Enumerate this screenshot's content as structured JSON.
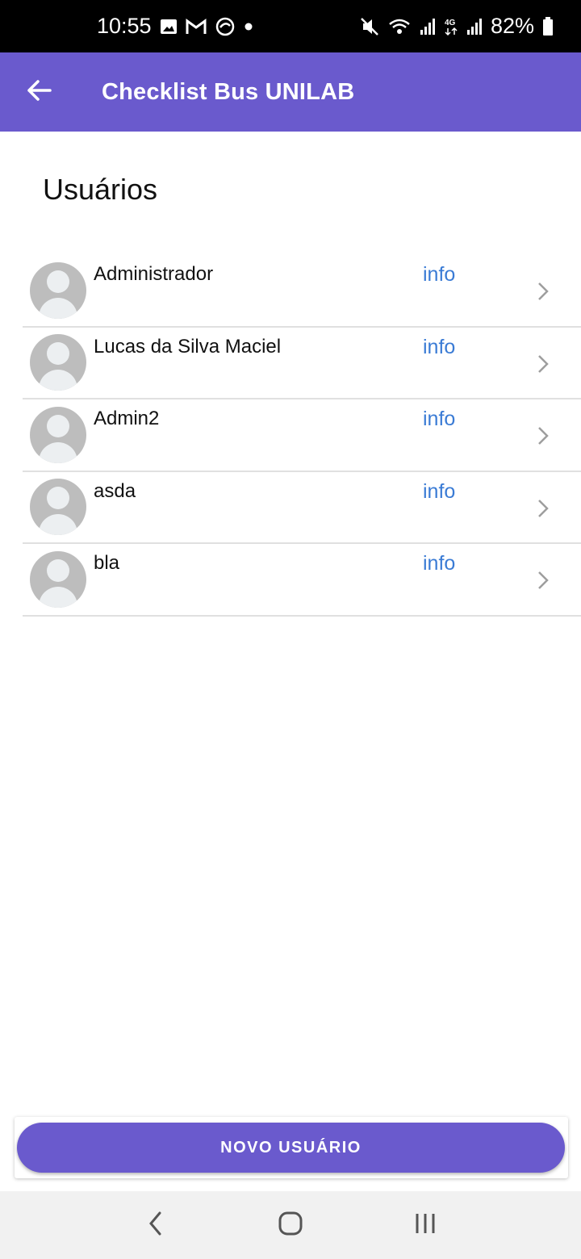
{
  "status_bar": {
    "time": "10:55",
    "battery": "82%",
    "left_icons": [
      "image-icon",
      "gmail-icon",
      "sync-icon",
      "dot-icon"
    ],
    "right_icons": [
      "mute-icon",
      "wifi-icon",
      "signal-icon",
      "4g-icon",
      "signal-icon",
      "battery-icon"
    ]
  },
  "app_bar": {
    "title": "Checklist Bus UNILAB",
    "back_icon": "arrow-left-icon"
  },
  "page": {
    "section_title": "Usuários"
  },
  "users": [
    {
      "name": "Administrador",
      "link": "info"
    },
    {
      "name": "Lucas da Silva Maciel",
      "link": "info"
    },
    {
      "name": "Admin2",
      "link": "info"
    },
    {
      "name": "asda",
      "link": "info"
    },
    {
      "name": "bla",
      "link": "info"
    }
  ],
  "actions": {
    "new_user_label": "NOVO USUÁRIO"
  },
  "nav_bar": {
    "items": [
      "back-nav-icon",
      "home-nav-icon",
      "recents-nav-icon"
    ]
  },
  "colors": {
    "primary": "#6a5acd",
    "link": "#3a7bd5",
    "avatar_bg": "#bdbdbd"
  }
}
